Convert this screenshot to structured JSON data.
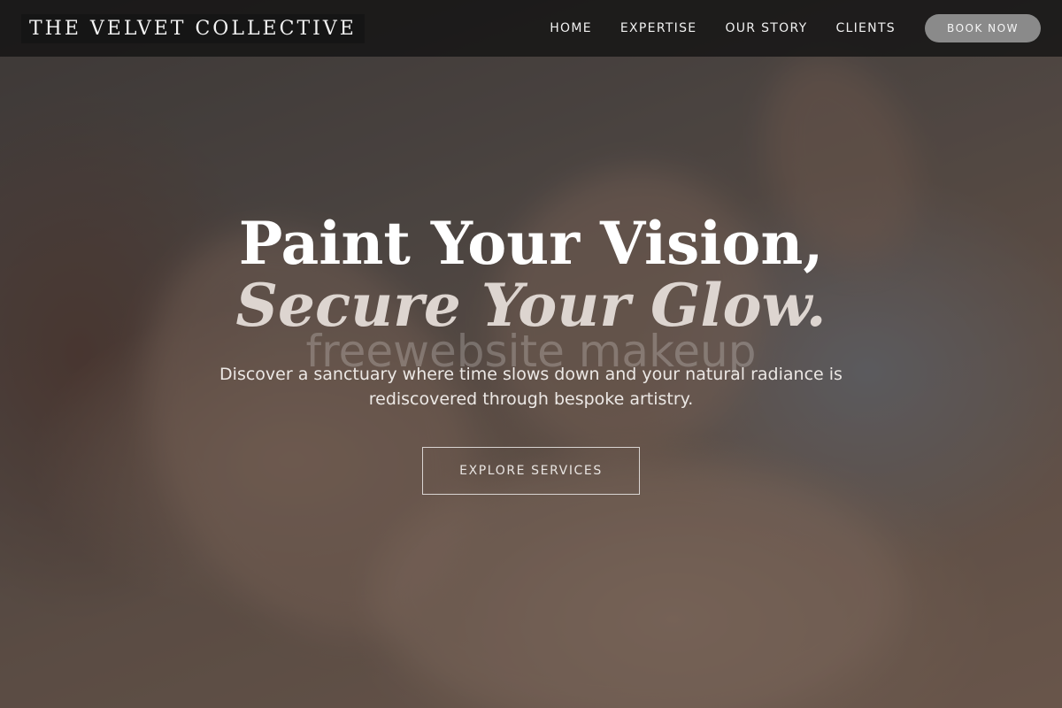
{
  "nav": {
    "logo": "THE VELVET COLLECTIVE",
    "links": [
      {
        "label": "HOME"
      },
      {
        "label": "EXPERTISE"
      },
      {
        "label": "OUR STORY"
      },
      {
        "label": "CLIENTS"
      }
    ],
    "cta_label": "BOOK NOW"
  },
  "hero": {
    "headline_line1": "Paint Your Vision,",
    "headline_line2": "Secure Your Glow.",
    "watermark": "freewebsite makeup",
    "subtitle": "Discover a sanctuary where time slows down and your natural radiance is rediscovered through bespoke artistry.",
    "button_label": "EXPLORE SERVICES"
  },
  "colors": {
    "nav_background": "#121212",
    "cta_background": "#8a8a8a",
    "text_primary": "#ffffff"
  }
}
